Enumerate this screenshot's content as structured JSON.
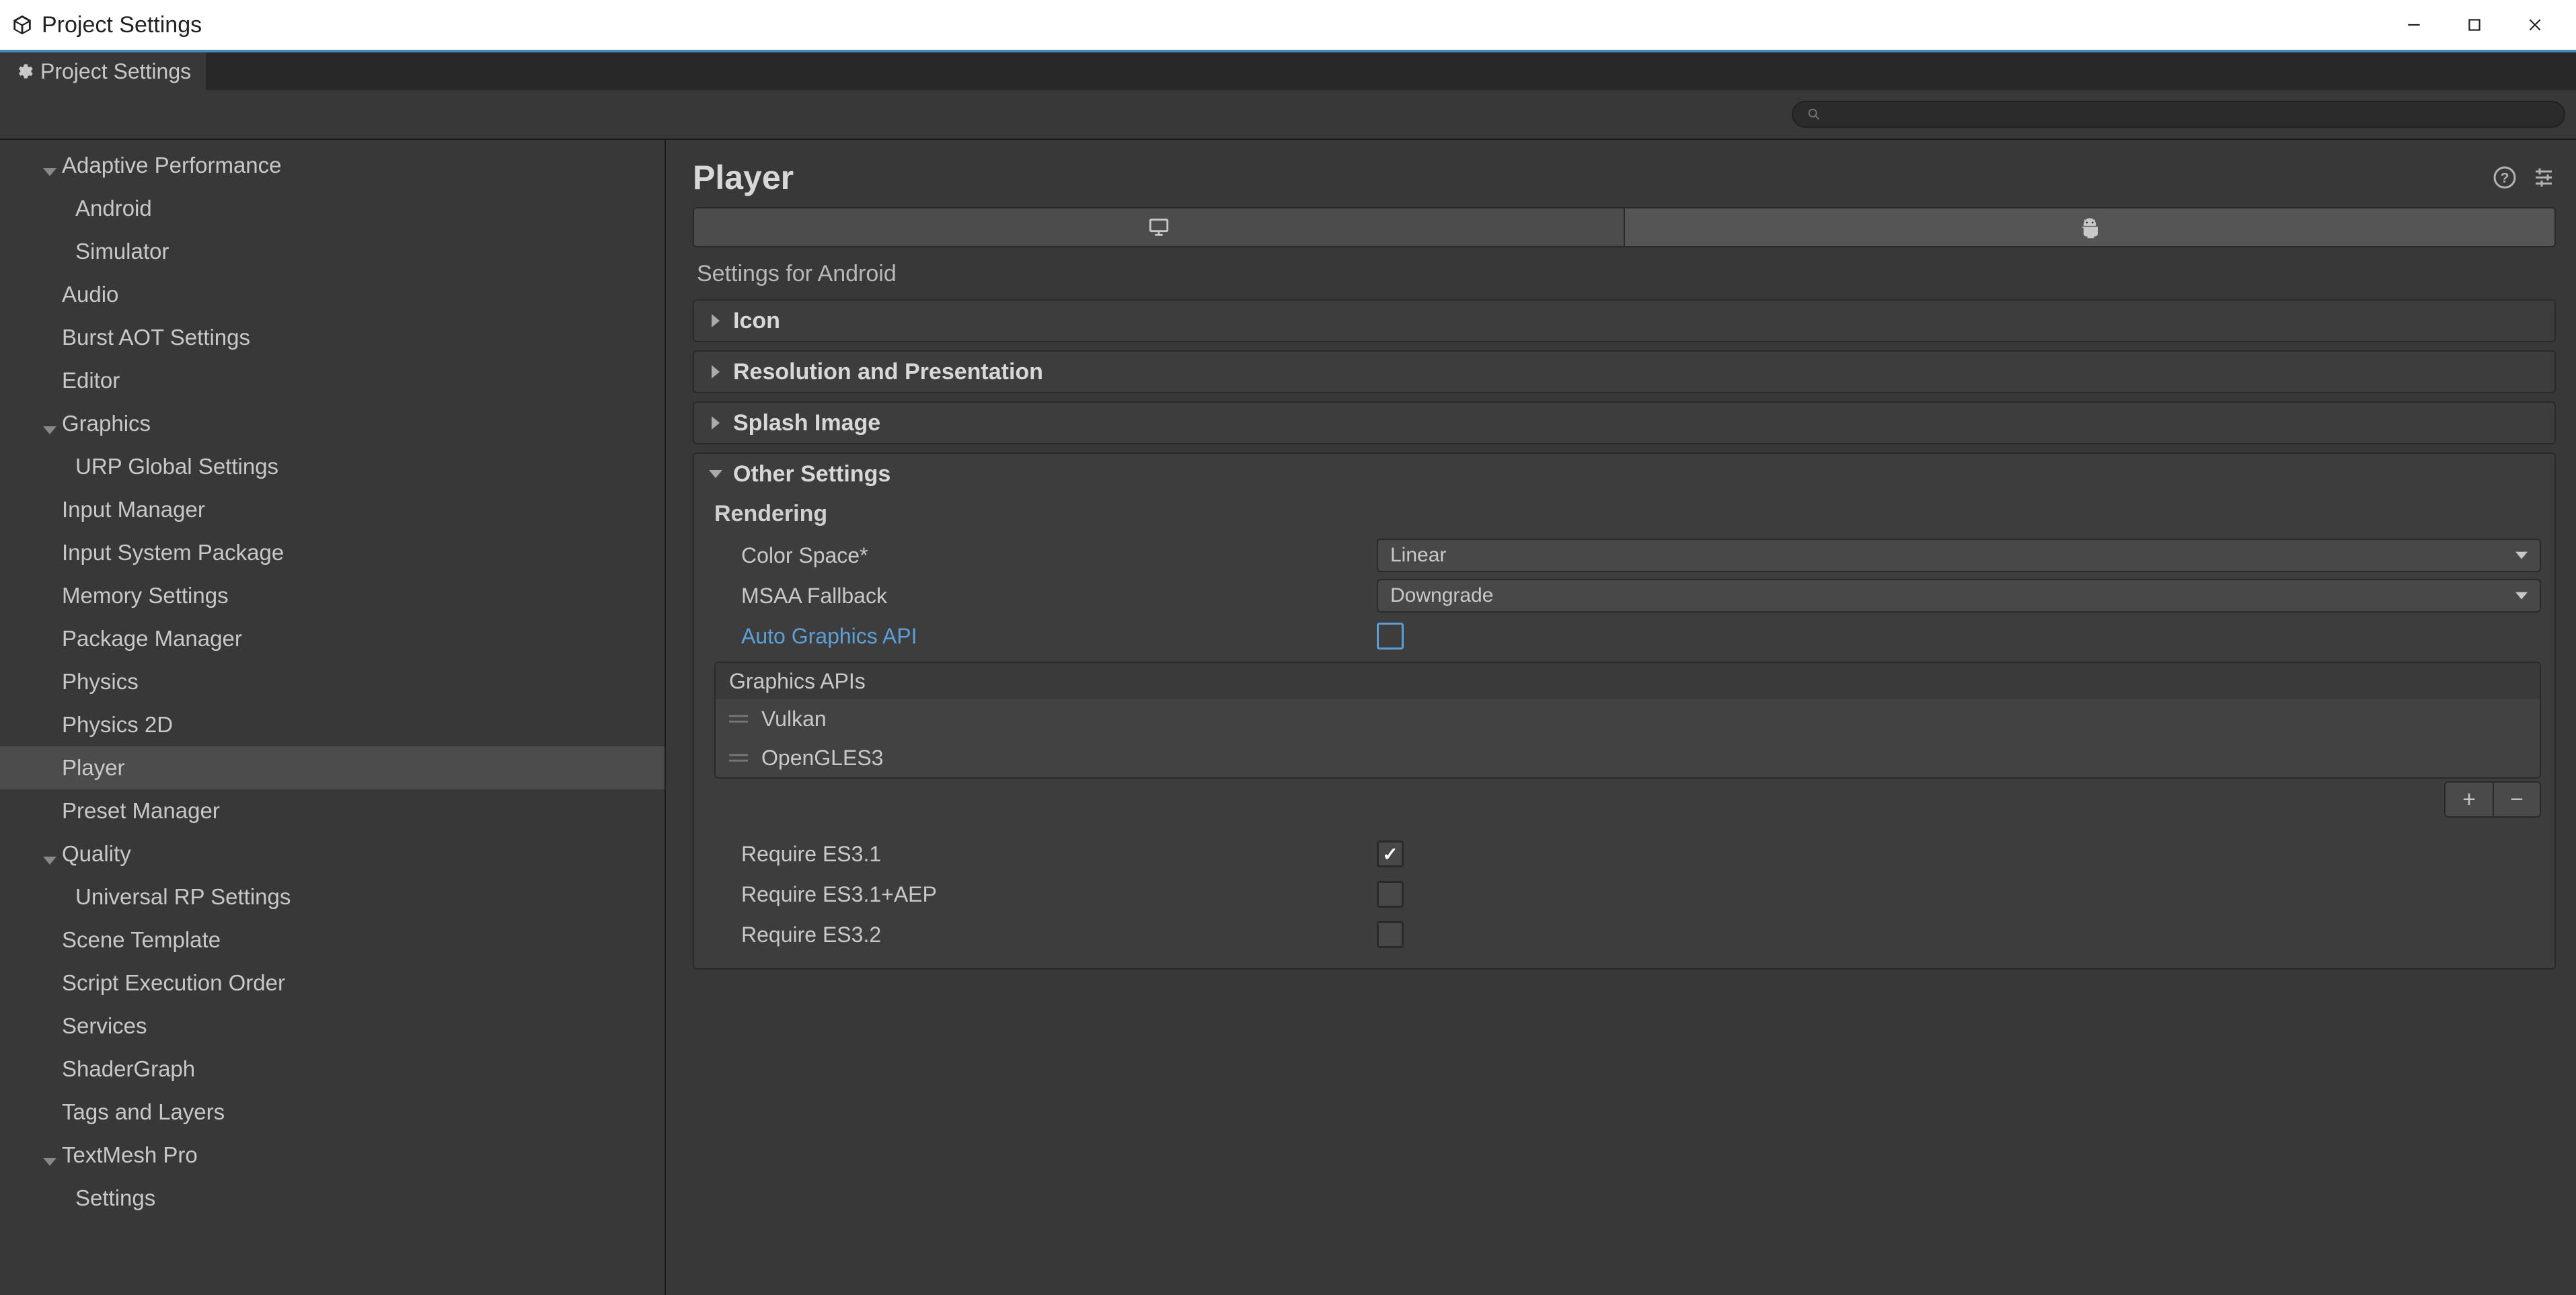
{
  "window": {
    "title": "Project Settings"
  },
  "tab": {
    "label": "Project Settings"
  },
  "sidebar": {
    "items": [
      {
        "label": "Adaptive Performance",
        "depth": 1,
        "expand": "down"
      },
      {
        "label": "Android",
        "depth": 2
      },
      {
        "label": "Simulator",
        "depth": 2
      },
      {
        "label": "Audio",
        "depth": 1
      },
      {
        "label": "Burst AOT Settings",
        "depth": 1
      },
      {
        "label": "Editor",
        "depth": 1
      },
      {
        "label": "Graphics",
        "depth": 1,
        "expand": "down"
      },
      {
        "label": "URP Global Settings",
        "depth": 2
      },
      {
        "label": "Input Manager",
        "depth": 1
      },
      {
        "label": "Input System Package",
        "depth": 1
      },
      {
        "label": "Memory Settings",
        "depth": 1
      },
      {
        "label": "Package Manager",
        "depth": 1
      },
      {
        "label": "Physics",
        "depth": 1
      },
      {
        "label": "Physics 2D",
        "depth": 1
      },
      {
        "label": "Player",
        "depth": 1,
        "selected": true
      },
      {
        "label": "Preset Manager",
        "depth": 1
      },
      {
        "label": "Quality",
        "depth": 1,
        "expand": "down"
      },
      {
        "label": "Universal RP Settings",
        "depth": 2
      },
      {
        "label": "Scene Template",
        "depth": 1
      },
      {
        "label": "Script Execution Order",
        "depth": 1
      },
      {
        "label": "Services",
        "depth": 1
      },
      {
        "label": "ShaderGraph",
        "depth": 1
      },
      {
        "label": "Tags and Layers",
        "depth": 1
      },
      {
        "label": "TextMesh Pro",
        "depth": 1,
        "expand": "down"
      },
      {
        "label": "Settings",
        "depth": 2
      }
    ]
  },
  "content": {
    "title": "Player",
    "subtitle": "Settings for Android",
    "sections": {
      "icon": "Icon",
      "resolution": "Resolution and Presentation",
      "splash": "Splash Image",
      "other": "Other Settings"
    },
    "rendering": {
      "heading": "Rendering",
      "colorSpaceLabel": "Color Space*",
      "colorSpaceValue": "Linear",
      "msaaLabel": "MSAA Fallback",
      "msaaValue": "Downgrade",
      "autoApiLabel": "Auto Graphics API",
      "apisHeader": "Graphics APIs",
      "apis": [
        "Vulkan",
        "OpenGLES3"
      ],
      "reqEs31": "Require ES3.1",
      "reqEs31aep": "Require ES3.1+AEP",
      "reqEs32": "Require ES3.2"
    }
  }
}
